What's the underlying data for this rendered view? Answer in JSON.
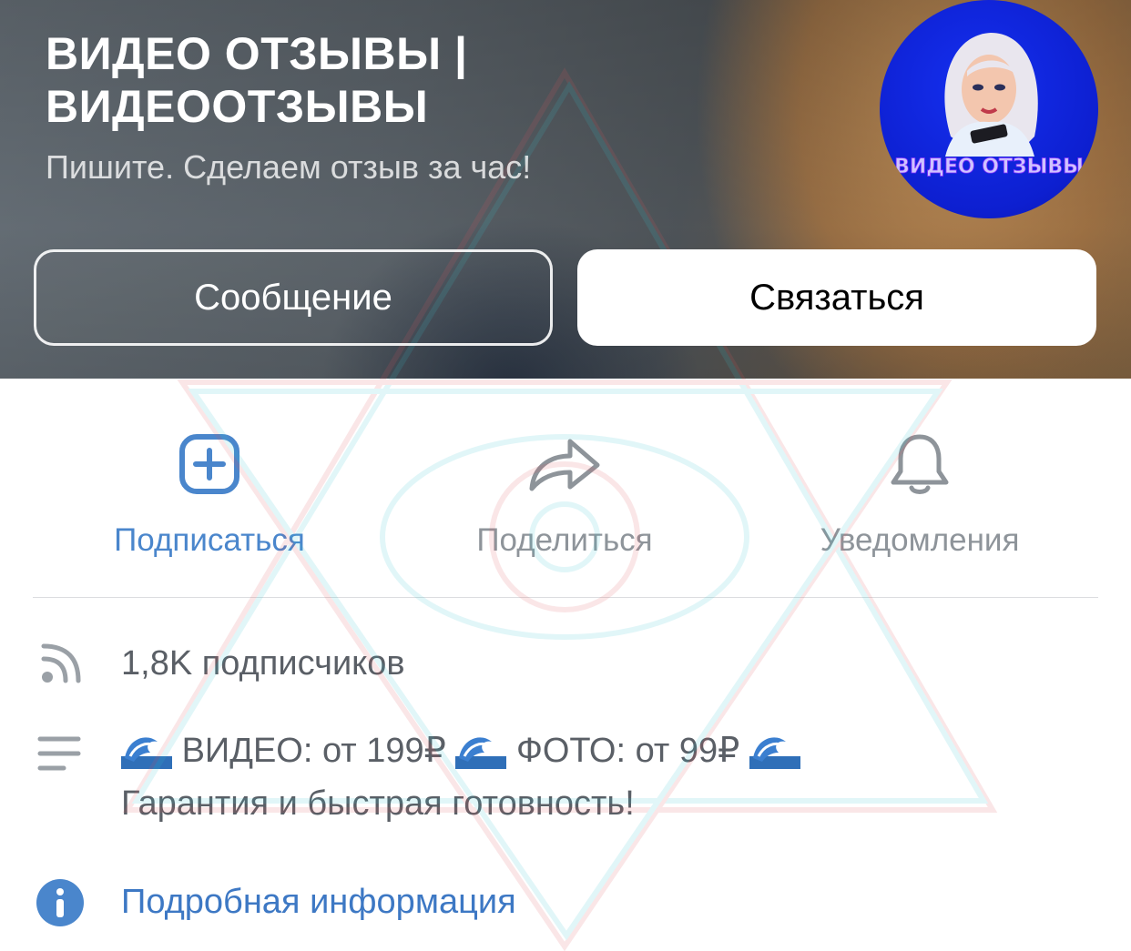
{
  "header": {
    "title": "ВИДЕО ОТЗЫВЫ | ВИДЕООТЗЫВЫ",
    "subtitle": "Пишите. Сделаем отзыв за час!",
    "avatar_text": "ВИДЕО ОТЗЫВЫ",
    "message_button": "Сообщение",
    "contact_button": "Связаться"
  },
  "actions": {
    "subscribe": "Подписаться",
    "share": "Поделиться",
    "notifications": "Уведомления"
  },
  "info": {
    "subscribers": "1,8K подписчиков",
    "description_part1": "ВИДЕО: от 199₽",
    "description_part2": "ФОТО: от 99₽",
    "description_line2": "Гарантия и быстрая готовность!",
    "details_link": "Подробная информация"
  },
  "colors": {
    "accent": "#4a86cc",
    "link": "#3d78c4",
    "muted": "#8e949a",
    "avatar_bg": "#1530f0"
  },
  "icons": [
    "plus-square-icon",
    "share-arrow-icon",
    "bell-icon",
    "rss-icon",
    "menu-lines-icon",
    "info-circle-icon",
    "wave-emoji-icon"
  ]
}
